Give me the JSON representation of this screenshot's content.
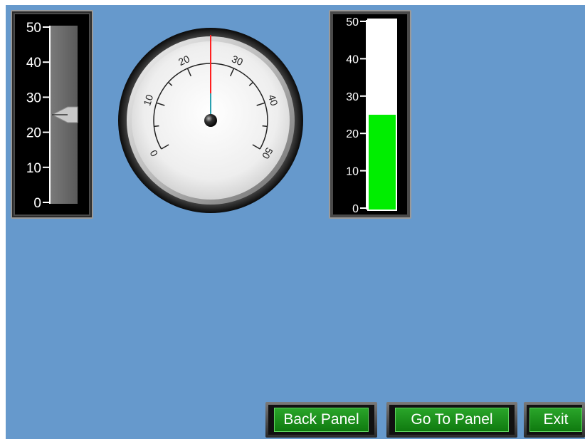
{
  "slider_gauge": {
    "ticks": [
      "50",
      "40",
      "30",
      "20",
      "10",
      "0"
    ],
    "min": 0,
    "max": 50,
    "value": 25
  },
  "round_dial": {
    "ticks": [
      "0",
      "10",
      "20",
      "30",
      "40",
      "50"
    ],
    "min": 0,
    "max": 50,
    "value": 25,
    "needle_color": "#ff2020"
  },
  "tank_gauge": {
    "ticks": [
      "50",
      "40",
      "30",
      "20",
      "10",
      "0"
    ],
    "min": 0,
    "max": 50,
    "value": 25,
    "fill_color": "#00ee00"
  },
  "buttons": {
    "back_panel": "Back Panel",
    "go_to_panel": "Go To Panel",
    "exit": "Exit"
  },
  "colors": {
    "background": "#6699cc",
    "button_green": "#1e9a1e"
  }
}
